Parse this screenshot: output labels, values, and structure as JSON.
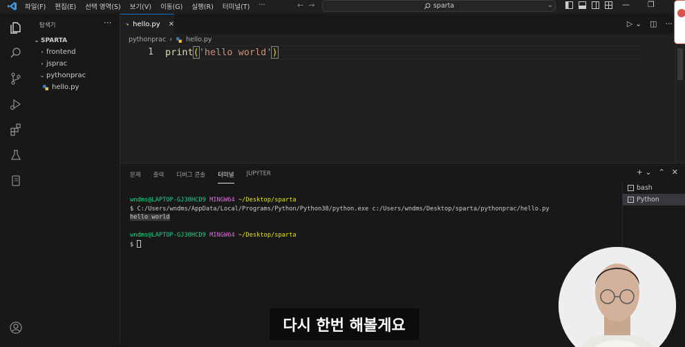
{
  "titlebar": {
    "menu": [
      "파일(F)",
      "편집(E)",
      "선택 영역(S)",
      "보기(V)",
      "이동(G)",
      "실행(R)",
      "터미널(T)",
      "···"
    ],
    "command_center": "sparta"
  },
  "sidebar": {
    "header": "탐색기",
    "more": "···",
    "root": "SPARTA",
    "items": [
      {
        "label": "frontend",
        "type": "folder",
        "expanded": false
      },
      {
        "label": "jsprac",
        "type": "folder",
        "expanded": false
      },
      {
        "label": "pythonprac",
        "type": "folder",
        "expanded": true
      },
      {
        "label": "hello.py",
        "type": "file"
      }
    ]
  },
  "editor": {
    "tab_label": "hello.py",
    "breadcrumb": [
      "pythonprac",
      "hello.py"
    ],
    "line_number": "1",
    "code": {
      "fn": "print",
      "open": "(",
      "str": "'hello world'",
      "close": ")"
    }
  },
  "panel": {
    "tabs": [
      "문제",
      "출력",
      "디버그 콘솔",
      "터미널",
      "JUPYTER"
    ],
    "active_tab": "터미널",
    "terminal": {
      "prompt1_user": "wndms@LAPTOP-GJ30HCD9",
      "prompt1_sys": "MINGW64",
      "prompt1_path": "~/Desktop/sparta",
      "command": "$ C:/Users/wndms/AppData/Local/Programs/Python/Python38/python.exe c:/Users/wndms/Desktop/sparta/pythonprac/hello.py",
      "output": "hello world",
      "prompt2_user": "wndms@LAPTOP-GJ30HCD9",
      "prompt2_sys": "MINGW64",
      "prompt2_path": "~/Desktop/sparta",
      "prompt_char": "$"
    },
    "terminal_list": [
      {
        "label": "bash",
        "selected": false
      },
      {
        "label": "Python",
        "selected": true
      }
    ]
  },
  "subtitle": "다시 한번 해볼게요",
  "colors": {
    "accent": "#0078d4",
    "function": "#dcdcaa",
    "string": "#ce9178",
    "terminal_user": "#23d18b",
    "terminal_system": "#d670d6",
    "terminal_path": "#e5e510"
  }
}
